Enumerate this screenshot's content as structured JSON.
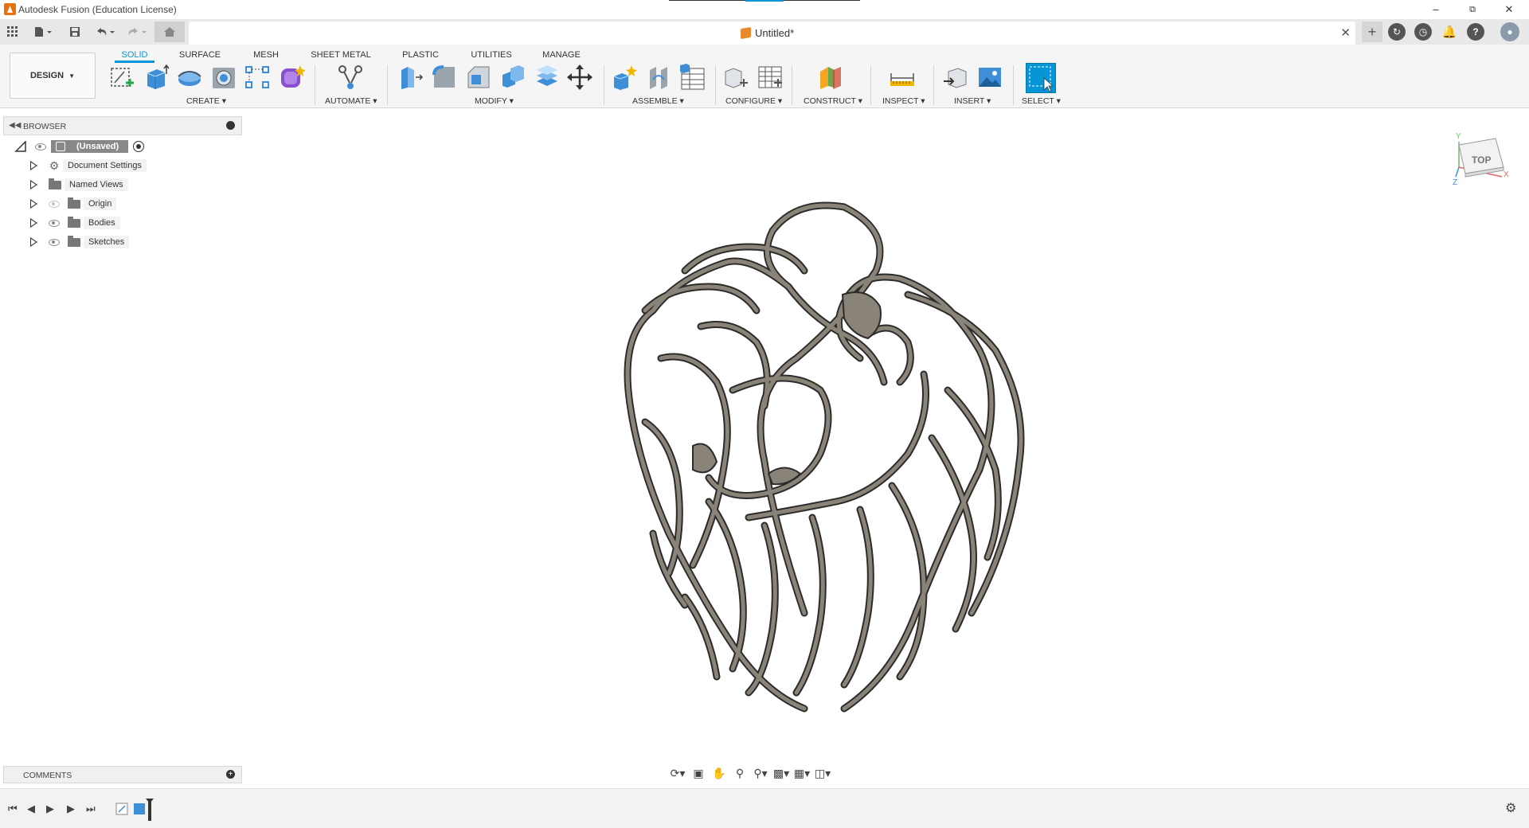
{
  "window": {
    "title": "Autodesk Fusion (Education License)"
  },
  "document_tab": {
    "title": "Untitled*",
    "close": "✕"
  },
  "ribbon": {
    "workspace": "DESIGN",
    "tabs": [
      "SOLID",
      "SURFACE",
      "MESH",
      "SHEET METAL",
      "PLASTIC",
      "UTILITIES",
      "MANAGE"
    ],
    "active_tab": "SOLID",
    "groups": {
      "create": "CREATE",
      "automate": "AUTOMATE",
      "modify": "MODIFY",
      "assemble": "ASSEMBLE",
      "configure": "CONFIGURE",
      "construct": "CONSTRUCT",
      "inspect": "INSPECT",
      "insert": "INSERT",
      "select": "SELECT"
    }
  },
  "browser": {
    "title": "BROWSER",
    "root": "(Unsaved)",
    "items": [
      {
        "label": "Document Settings",
        "icon": "gear-icon"
      },
      {
        "label": "Named Views",
        "icon": "folder-icon"
      },
      {
        "label": "Origin",
        "icon": "folder-icon",
        "hidden": true
      },
      {
        "label": "Bodies",
        "icon": "folder-icon"
      },
      {
        "label": "Sketches",
        "icon": "folder-icon"
      }
    ]
  },
  "comments": {
    "title": "COMMENTS"
  },
  "viewcube": {
    "face": "TOP",
    "axes": {
      "x": "X",
      "y": "Y",
      "z": "Z"
    }
  },
  "colors": {
    "accent": "#0696d7",
    "model_fill": "#8a8478",
    "model_edge": "#2b2b2b",
    "ribbon_bg": "#f5f5f5"
  }
}
